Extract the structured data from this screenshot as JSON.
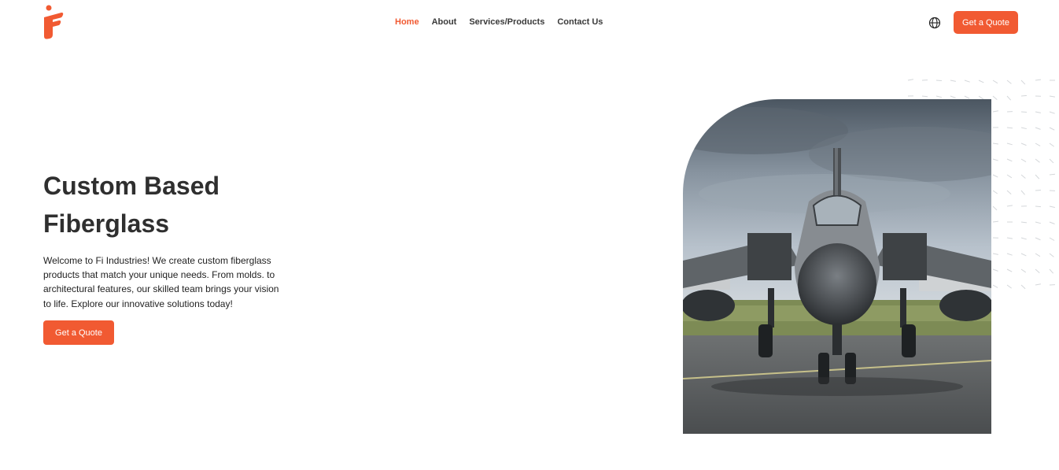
{
  "header": {
    "logo_icon": "fi-logo-icon",
    "nav": [
      {
        "label": "Home",
        "active": true
      },
      {
        "label": "About",
        "active": false
      },
      {
        "label": "Services/Products",
        "active": false
      },
      {
        "label": "Contact Us",
        "active": false
      }
    ],
    "language_icon": "globe-icon",
    "quote_button": "Get a Quote"
  },
  "hero": {
    "title_line1": "Custom Based",
    "title_line2": "Fiberglass",
    "description": "Welcome to Fi Industries! We create custom fiberglass products that match your unique needs. From molds. to architectural features, our skilled team brings your vision to life. Explore our innovative solutions today!",
    "quote_button": "Get a Quote",
    "image_icon": "fighter-jet-image"
  },
  "colors": {
    "accent": "#f15a32",
    "text": "#2f2f2f"
  }
}
